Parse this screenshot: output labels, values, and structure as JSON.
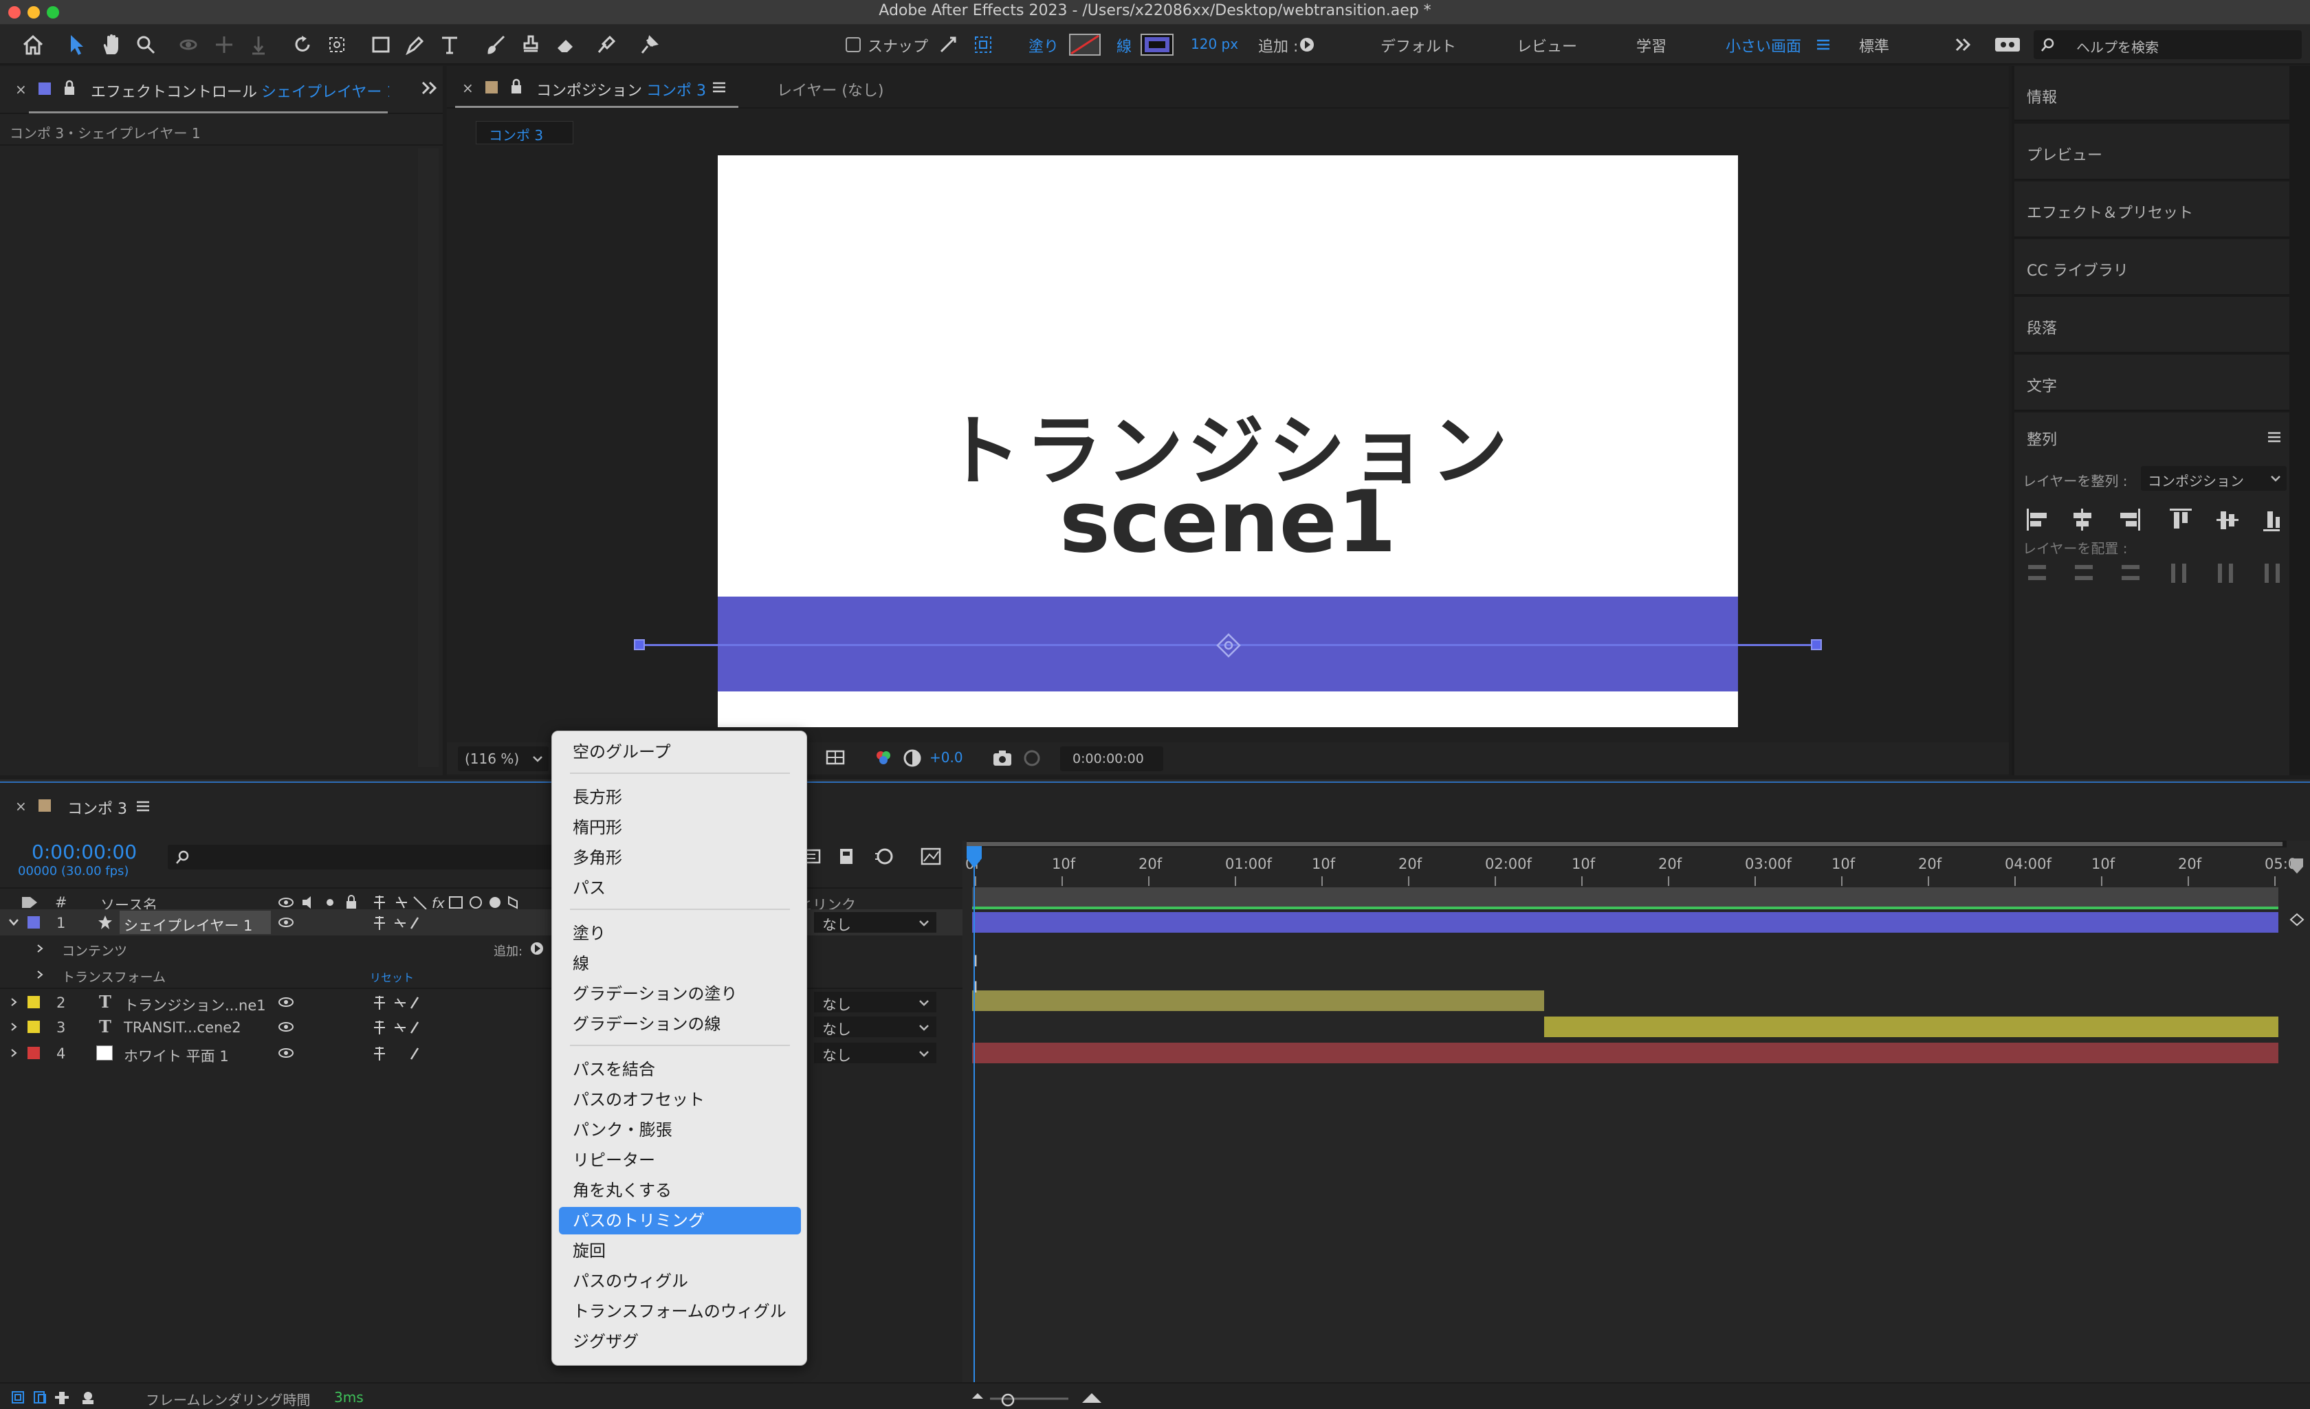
{
  "window": {
    "title": "Adobe After Effects 2023 - /Users/x22086xx/Desktop/webtransition.aep *"
  },
  "toolbar": {
    "snap_label": "スナップ",
    "fill_label": "塗り",
    "stroke_label": "線",
    "stroke_width": "120 px",
    "add_label": "追加 :",
    "workspaces": [
      "デフォルト",
      "レビュー",
      "学習",
      "小さい画面",
      "標準"
    ],
    "active_workspace": "小さい画面",
    "search_placeholder": "ヘルプを検索",
    "stroke_color": "#5A59C9",
    "accent_color": "#2D8CEB"
  },
  "effect_panel": {
    "tab_label": "エフェクトコントロール",
    "tab_target": "シェイプレイヤー 1",
    "breadcrumb": "コンポ 3・シェイプレイヤー 1"
  },
  "comp_panel": {
    "tab_label": "コンポジション",
    "tab_target": "コンポ 3",
    "layer_tab": "レイヤー (なし)",
    "comp_chip": "コンポ 3",
    "canvas_line1": "トランジション",
    "canvas_line2": "scene1",
    "shape_color": "#5A59C9",
    "zoom": "(116 %)",
    "exposure": "+0.0",
    "timecode": "0:00:00:00"
  },
  "right_panel": {
    "items": [
      "情報",
      "プレビュー",
      "エフェクト＆プリセット",
      "CC ライブラリ",
      "段落",
      "文字"
    ],
    "align_title": "整列",
    "align_to_label": "レイヤーを整列 :",
    "align_to_value": "コンポジション",
    "distribute_label": "レイヤーを配置 :"
  },
  "timeline": {
    "tab_label": "コンポ 3",
    "timecode": "0:00:00:00",
    "fps_info": "00000 (30.00 fps)",
    "col_source": "ソース名",
    "col_parent": "親とリンク",
    "col_hash": "#",
    "ruler_labels": [
      "0f",
      "10f",
      "20f",
      "01:00f",
      "10f",
      "20f",
      "02:00f",
      "10f",
      "20f",
      "03:00f",
      "10f",
      "20f",
      "04:00f",
      "10f",
      "20f",
      "05:0"
    ],
    "layers": [
      {
        "num": "1",
        "name": "シェイプレイヤー 1",
        "parent": "なし",
        "label_color": "#6a72e3",
        "bar_color": "#5a59c9"
      },
      {
        "num": "2",
        "name": "トランジション...ne1",
        "parent": "なし",
        "label_color": "#e8d12c",
        "bar_color": "#938e48"
      },
      {
        "num": "3",
        "name": "TRANSIT...cene2",
        "parent": "なし",
        "label_color": "#e8d12c",
        "bar_color": "#a8a23a"
      },
      {
        "num": "4",
        "name": "ホワイト 平面 1",
        "parent": "なし",
        "label_color": "#d23a3a",
        "bar_color": "#8a3a3f"
      }
    ],
    "sub_rows": [
      "コンテンツ",
      "トランスフォーム"
    ],
    "add_label": "追加:",
    "reset_label": "リセット",
    "footer_label": "フレームレンダリング時間",
    "footer_value": "3ms"
  },
  "context_menu": {
    "selected": "パスのトリミング",
    "groups": [
      [
        "空のグループ"
      ],
      [
        "長方形",
        "楕円形",
        "多角形",
        "パス"
      ],
      [
        "塗り",
        "線",
        "グラデーションの塗り",
        "グラデーションの線"
      ],
      [
        "パスを結合",
        "パスのオフセット",
        "パンク・膨張",
        "リピーター",
        "角を丸くする",
        "パスのトリミング",
        "旋回",
        "パスのウィグル",
        "トランスフォームのウィグル",
        "ジグザグ"
      ]
    ]
  }
}
